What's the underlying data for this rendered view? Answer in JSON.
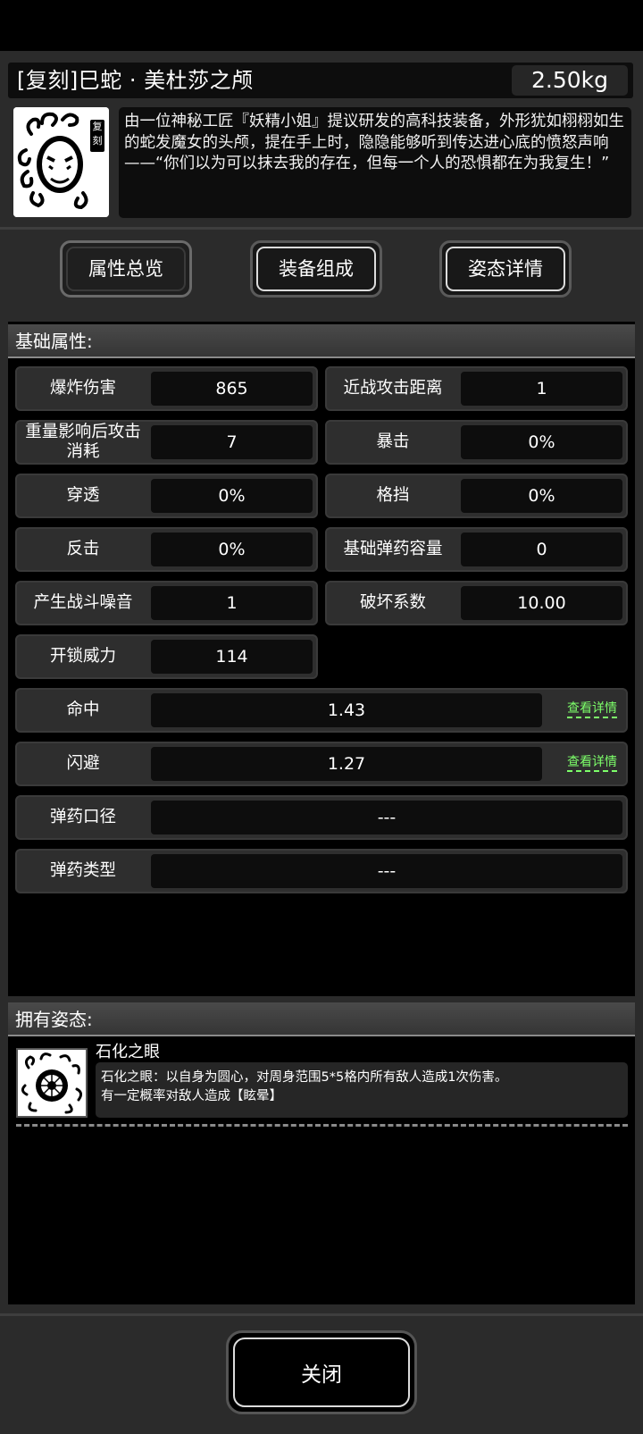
{
  "item": {
    "title": "[复刻]巳蛇 · 美杜莎之颅",
    "weight": "2.50kg",
    "badge": "复刻",
    "description": "由一位神秘工匠『妖精小姐』提议研发的高科技装备，外形犹如栩栩如生的蛇发魔女的头颅，提在手上时，隐隐能够听到传达进心底的愤怒声响——“你们以为可以抹去我的存在，但每一个人的恐惧都在为我复生！”"
  },
  "tabs": [
    {
      "label": "属性总览",
      "active": true
    },
    {
      "label": "装备组成",
      "active": false
    },
    {
      "label": "姿态详情",
      "active": false
    }
  ],
  "attributes": {
    "header": "基础属性:",
    "items": [
      {
        "label": "爆炸伤害",
        "value": "865"
      },
      {
        "label": "近战攻击距离",
        "value": "1"
      },
      {
        "label": "重量影响后攻击消耗",
        "value": "7"
      },
      {
        "label": "暴击",
        "value": "0%"
      },
      {
        "label": "穿透",
        "value": "0%"
      },
      {
        "label": "格挡",
        "value": "0%"
      },
      {
        "label": "反击",
        "value": "0%"
      },
      {
        "label": "基础弹药容量",
        "value": "0"
      },
      {
        "label": "产生战斗噪音",
        "value": "1"
      },
      {
        "label": "破坏系数",
        "value": "10.00"
      },
      {
        "label": "开锁威力",
        "value": "114"
      }
    ],
    "wide": [
      {
        "label": "命中",
        "value": "1.43",
        "link": "查看详情"
      },
      {
        "label": "闪避",
        "value": "1.27",
        "link": "查看详情"
      },
      {
        "label": "弹药口径",
        "value": "---"
      },
      {
        "label": "弹药类型",
        "value": "---"
      }
    ]
  },
  "stances": {
    "header": "拥有姿态:",
    "items": [
      {
        "name": "石化之眼",
        "description_line1": "石化之眼：以自身为圆心，对周身范围5*5格内所有敌人造成1次伤害。",
        "description_line2": "有一定概率对敌人造成【眩晕】"
      }
    ]
  },
  "close_button": "关闭"
}
